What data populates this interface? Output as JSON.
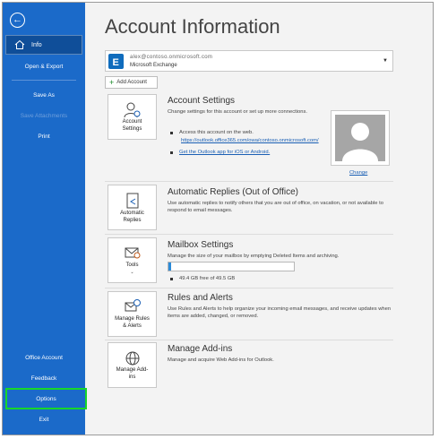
{
  "sidebar": {
    "info_label": "Info",
    "items": [
      {
        "label": "Open & Export",
        "disabled": false
      },
      {
        "label": "Save As",
        "disabled": false
      },
      {
        "label": "Save Attachments",
        "disabled": true
      },
      {
        "label": "Print",
        "disabled": false
      },
      {
        "label": "Office Account",
        "disabled": false
      },
      {
        "label": "Feedback",
        "disabled": false
      },
      {
        "label": "Options",
        "disabled": false,
        "highlighted": true
      },
      {
        "label": "Exit",
        "disabled": false
      }
    ]
  },
  "page": {
    "title": "Account Information"
  },
  "account": {
    "email": "alex@contoso.onmicrosoft.com",
    "type": "Microsoft Exchange",
    "add_label": "Add Account"
  },
  "settings": {
    "tile": {
      "line1": "Account",
      "line2": "Settings"
    },
    "title": "Account Settings",
    "desc": "Change settings for this account or set up more connections.",
    "bullet1": "Access this account on the web.",
    "link1": "https://outlook.office365.com/owa/contoso.onmicrosoft.com/",
    "link2": "Get the Outlook app for iOS or Android.",
    "change": "Change"
  },
  "auto_replies": {
    "tile": {
      "line1": "Automatic",
      "line2": "Replies"
    },
    "title": "Automatic Replies (Out of Office)",
    "desc": "Use automatic replies to notify others that you are out of office, on vacation, or not available to respond to email messages."
  },
  "mailbox": {
    "tile": {
      "line1": "Tools"
    },
    "title": "Mailbox Settings",
    "desc": "Manage the size of your mailbox by emptying Deleted Items and archiving.",
    "storage": "49.4 GB free of 49.5 GB",
    "used_fraction": 0.02
  },
  "rules": {
    "tile": {
      "line1": "Manage Rules",
      "line2": "& Alerts"
    },
    "title": "Rules and Alerts",
    "desc": "Use Rules and Alerts to help organize your incoming email messages, and receive updates when items are added, changed, or removed."
  },
  "addins": {
    "tile": {
      "line1": "Manage Add-",
      "line2": "ins"
    },
    "title": "Manage Add-ins",
    "desc": "Manage and acquire Web Add-ins for Outlook."
  },
  "colors": {
    "sidebar": "#1b6ac9",
    "highlight": "#17d62a",
    "link": "#1a5fb4"
  }
}
